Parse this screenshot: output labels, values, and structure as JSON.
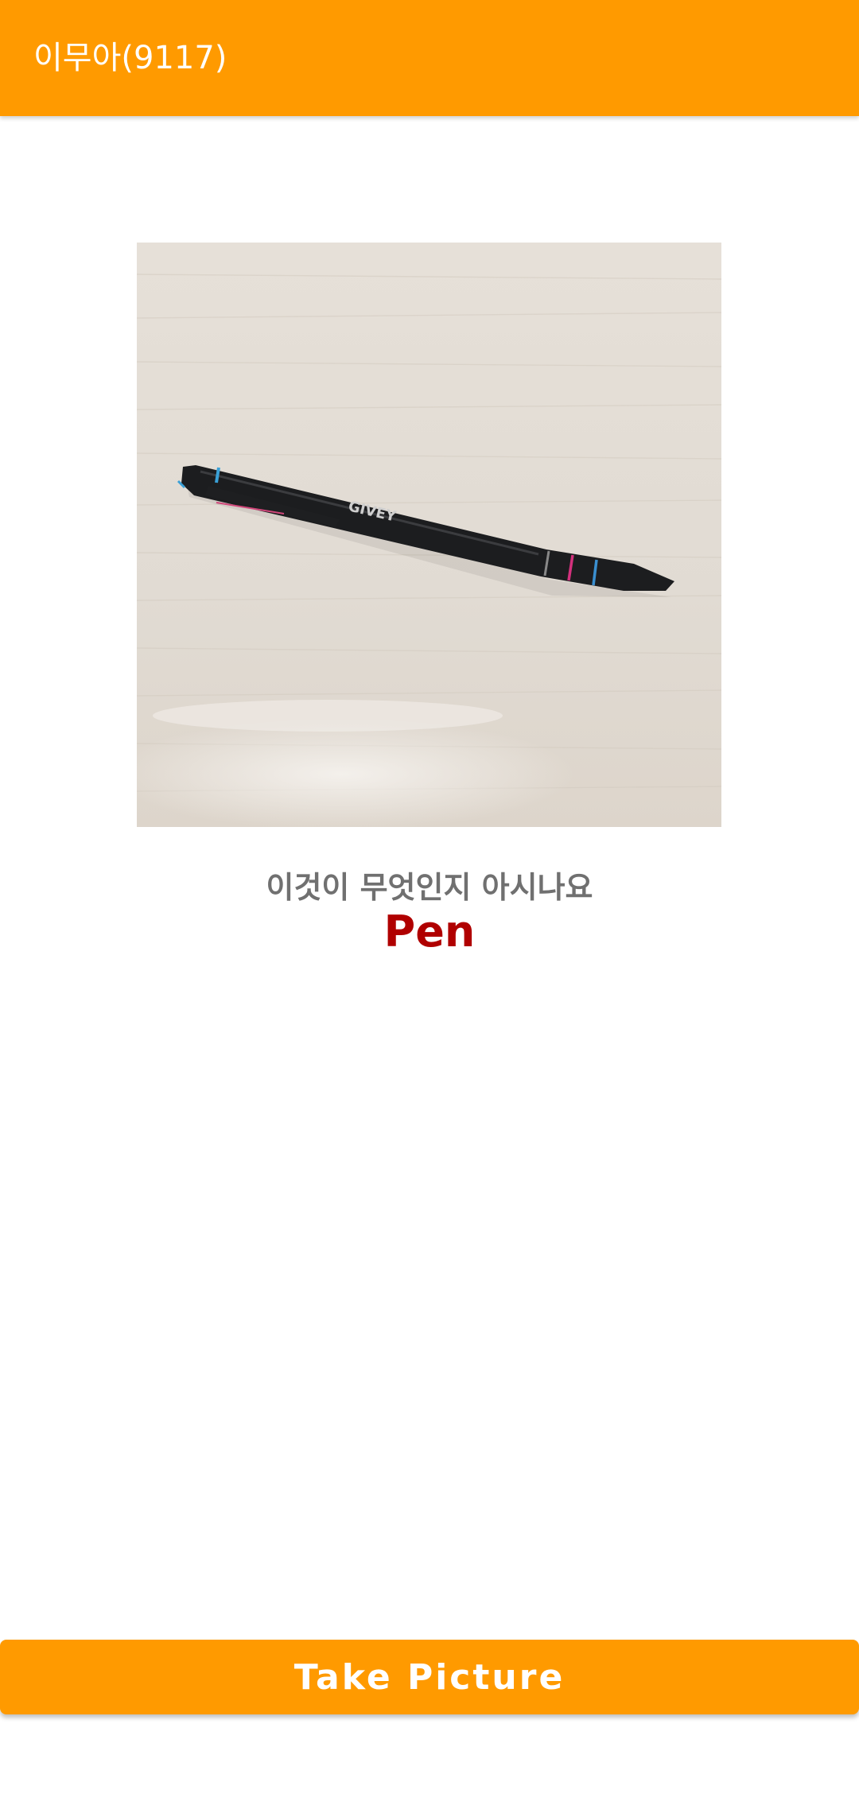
{
  "app_bar": {
    "title": "이무아(9117)"
  },
  "photo": {
    "subject": "pen-photo",
    "pen_brand_text": "GIVEY"
  },
  "question_text": "이것이 무엇인지 아시나요",
  "answer_text": "Pen",
  "take_picture_button": {
    "label": "Take Picture"
  },
  "colors": {
    "accent": "#FF9A00",
    "answer": "#B00000",
    "question": "#707070"
  }
}
